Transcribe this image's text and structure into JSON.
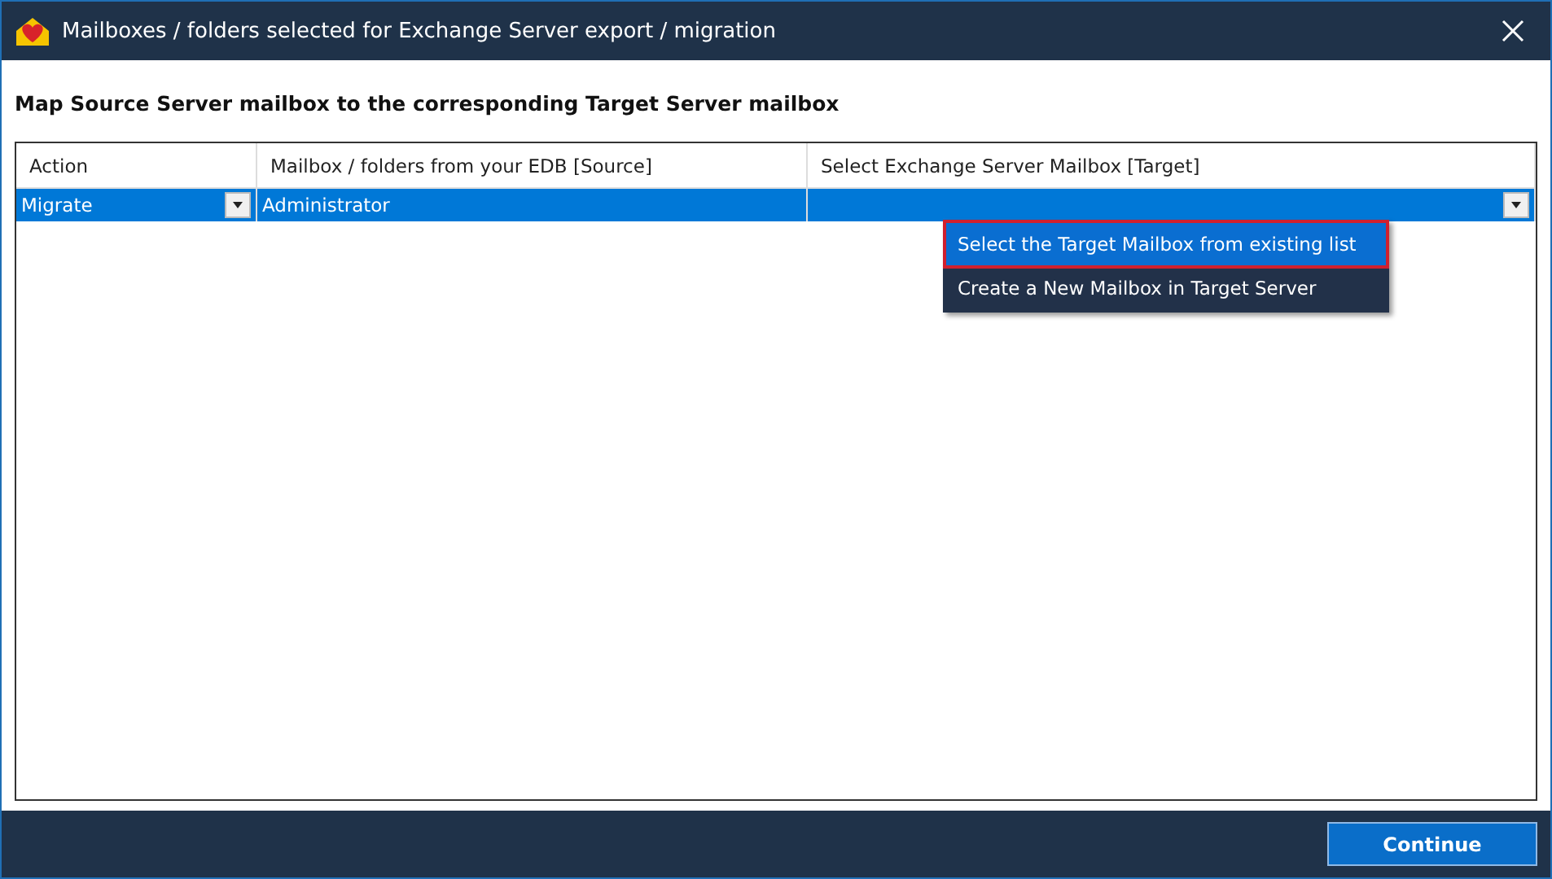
{
  "window": {
    "title": "Mailboxes / folders selected for Exchange Server export / migration"
  },
  "instruction": "Map Source Server mailbox to the corresponding Target Server mailbox",
  "table": {
    "columns": [
      "Action",
      "Mailbox / folders from your EDB [Source]",
      "Select Exchange Server Mailbox [Target]"
    ],
    "rows": [
      {
        "action": "Migrate",
        "source": "Administrator",
        "target_expanded": true,
        "selected": true
      }
    ]
  },
  "dropdown_menu": [
    {
      "label": "Select the Target Mailbox from existing list",
      "selected": true
    },
    {
      "label": "Create a New Mailbox in Target Server",
      "selected": false
    }
  ],
  "buttons": [
    "Continue"
  ]
}
